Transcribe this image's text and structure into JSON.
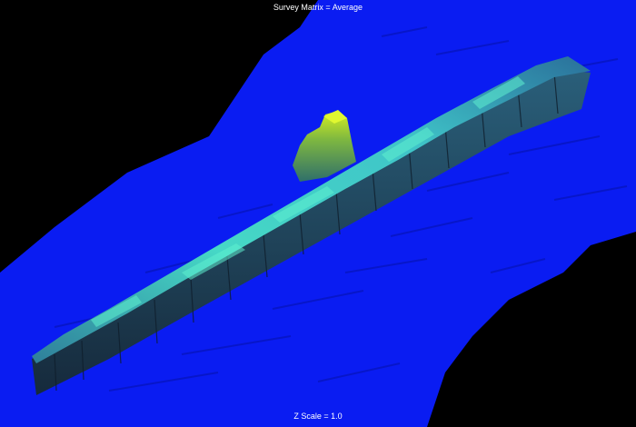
{
  "viewer": {
    "title": "Survey Matrix = Average",
    "z_scale_label": "Z Scale = 1.0"
  },
  "colors": {
    "background": "#000000",
    "seafloor": "#0a1cf2",
    "seafloor_dark": "#0713c8",
    "wreck_low": "#1e3a55",
    "wreck_mid": "#2f8fa8",
    "wreck_high": "#45e0c0",
    "wreck_peak": "#c8f020"
  },
  "scene": {
    "subject": "sonar-bathymetry-shipwreck"
  }
}
